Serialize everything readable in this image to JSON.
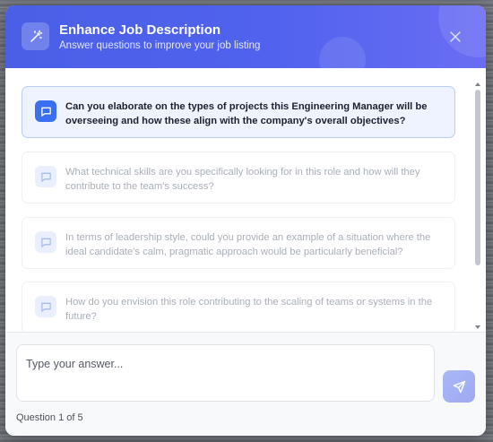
{
  "header": {
    "title": "Enhance Job Description",
    "subtitle": "Answer questions to improve your job listing",
    "icon": "magic-wand-icon",
    "close_icon": "close-icon"
  },
  "questions": [
    {
      "text": "Can you elaborate on the types of projects this Engineering Manager will be overseeing and how these align with the company's overall objectives?",
      "active": true
    },
    {
      "text": "What technical skills are you specifically looking for in this role and how will they contribute to the team's success?",
      "active": false
    },
    {
      "text": "In terms of leadership style, could you provide an example of a situation where the ideal candidate's calm, pragmatic approach would be particularly beneficial?",
      "active": false
    },
    {
      "text": "How do you envision this role contributing to the scaling of teams or systems in the future?",
      "active": false
    }
  ],
  "answer": {
    "placeholder": "Type your answer...",
    "value": ""
  },
  "progress": {
    "label": "Question 1 of 5",
    "current": 1,
    "total": 5
  },
  "colors": {
    "header_start": "#4a5fe6",
    "header_end": "#6a6df3",
    "active_card_bg": "#eef3ff",
    "active_icon_bg": "#3a6ff2",
    "send_button": "#a9b8f7"
  }
}
